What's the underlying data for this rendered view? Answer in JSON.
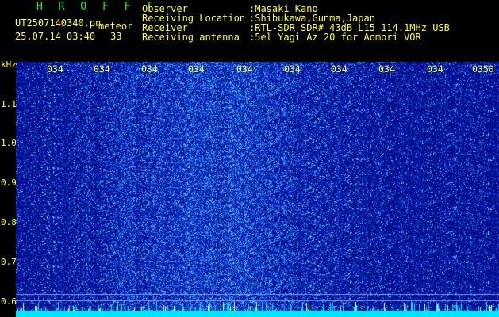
{
  "header": {
    "title": "H R O F F T",
    "filename": "UT2507140340.pn",
    "label_type": "meteor",
    "datetime": "25.07.14 03:40",
    "count": "33",
    "info": [
      {
        "label": "Observer",
        "value": ":Masaki Kano"
      },
      {
        "label": "Receiving Location",
        "value": ":Shibukawa,Gunma,Japan"
      },
      {
        "label": "Receiver",
        "value": ":RTL-SDR SDR# 43dB L15 114.1MHz USB"
      },
      {
        "label": "Receiving antenna",
        "value": ":5el Yagi Az 20 for Aomori VOR"
      }
    ]
  },
  "axis": {
    "y_unit": "kHz",
    "y_ticks": [
      "1.1",
      "1.0",
      "0.9",
      "0.8",
      "0.7",
      "0.6"
    ],
    "x_ticks": [
      "034",
      "034",
      "034",
      "034",
      "034",
      "034",
      "034",
      "034",
      "034",
      "0350"
    ]
  },
  "colors": {
    "background": "#000000",
    "header_text": "#2ee62e",
    "highlight_text": "#ffff33",
    "spectrogram_base": "#000c8c",
    "noise_speck": "#2a6bff",
    "bright_speck": "#7fe0ff",
    "baseline": "#00e5ff"
  }
}
